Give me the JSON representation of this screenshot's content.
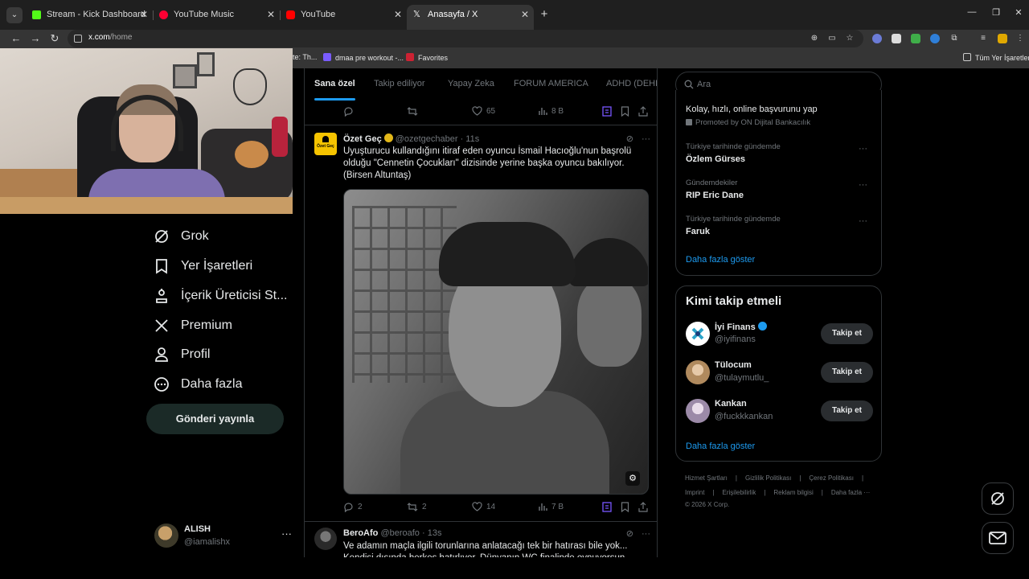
{
  "browser": {
    "tabs": [
      {
        "label": "Stream - Kick Dashboard",
        "favicon_color": "#53fc18"
      },
      {
        "label": "YouTube Music",
        "favicon_color": "#ff0033"
      },
      {
        "label": "YouTube",
        "favicon_color": "#ff0000"
      },
      {
        "label": "Anasayfa / X",
        "favicon_color": "#ffffff"
      }
    ],
    "new_tab": "+",
    "url_host": "x.com",
    "url_path": "/home",
    "bookmarks": [
      {
        "label": "te: Th...",
        "color": "#888888"
      },
      {
        "label": "dmaa pre workout -...",
        "color": "#7a5cff"
      },
      {
        "label": "Favorites",
        "color": "#cc2233"
      }
    ],
    "all_bookmarks": "Tüm Yer İşaretleri"
  },
  "nav": {
    "items": [
      {
        "label": "Grok",
        "icon": "grok-icon"
      },
      {
        "label": "Yer İşaretleri",
        "icon": "bookmark-icon"
      },
      {
        "label": "İçerik Üreticisi St...",
        "icon": "creator-studio-icon"
      },
      {
        "label": "Premium",
        "icon": "x-logo-icon"
      },
      {
        "label": "Profil",
        "icon": "profile-icon"
      },
      {
        "label": "Daha fazla",
        "icon": "more-circle-icon"
      }
    ],
    "post_button": "Gönderi yayınla",
    "account": {
      "name": "ALISH",
      "handle": "@iamalishx",
      "more": "···"
    }
  },
  "timeline": {
    "tabs": [
      "Sana özel",
      "Takip ediliyor",
      "Yapay Zeka",
      "FORUM AMERICA",
      "ADHD (DEHB"
    ],
    "prev_actions": {
      "replies": "",
      "reposts": "",
      "likes": "65",
      "views": "8 B"
    },
    "posts": [
      {
        "name": "Özet Geç",
        "handle": "@ozetgechaber",
        "time": "· 11s",
        "avatar_text": "Özet Geç",
        "text": "Uyuşturucu kullandığını itiraf eden oyuncu İsmail Hacıoğlu'nun başrolü olduğu \"Cennetin Çocukları\" dizisinde yerine başka oyuncu bakılıyor. (Birsen Altuntaş)",
        "actions": {
          "replies": "2",
          "reposts": "2",
          "likes": "14",
          "views": "7 B"
        }
      },
      {
        "name": "BeroAfo",
        "handle": "@beroafo",
        "time": "· 13s",
        "text": "Ve adamın maçla ilgili torunlarına anlatacağı tek bir hatırası bile yok... Kendisi dışında herkes hatırlıyor. Dünyanın WC finalinde oynuyorsun ama..."
      }
    ]
  },
  "right": {
    "search_placeholder": "Ara",
    "promo": {
      "title": "Kolay, hızlı, online başvurunu yap",
      "promoted": "Promoted by ON Dijital Bankacılık"
    },
    "trends": [
      {
        "context": "Türkiye tarihinde gündemde",
        "title": "Özlem Gürses"
      },
      {
        "context": "Gündemdekiler",
        "title": "RIP Eric Dane"
      },
      {
        "context": "Türkiye tarihinde gündemde",
        "title": "Faruk"
      }
    ],
    "show_more": "Daha fazla göster",
    "who_to_follow": {
      "title": "Kimi takip etmeli",
      "follow_label": "Takip et",
      "accounts": [
        {
          "name": "İyi Finans",
          "handle": "@iyifinans",
          "color": "#2aa3c9"
        },
        {
          "name": "Tülocum",
          "handle": "@tulaymutlu_",
          "color": "#c9a27a"
        },
        {
          "name": "Kankan",
          "handle": "@fuckkkankan",
          "color": "#b8a9c9"
        }
      ]
    },
    "footer_links": [
      "Hizmet Şartları",
      "Gizlilik Politikası",
      "Çerez Politikası",
      "Imprint",
      "Erişilebilirlik",
      "Reklam bilgisi",
      "Daha fazla ···"
    ],
    "copyright": "© 2026 X Corp."
  },
  "colors": {
    "accent": "#1d9bf0",
    "verified_gold": "#e2b719",
    "verified_blue": "#1d9bf0"
  }
}
